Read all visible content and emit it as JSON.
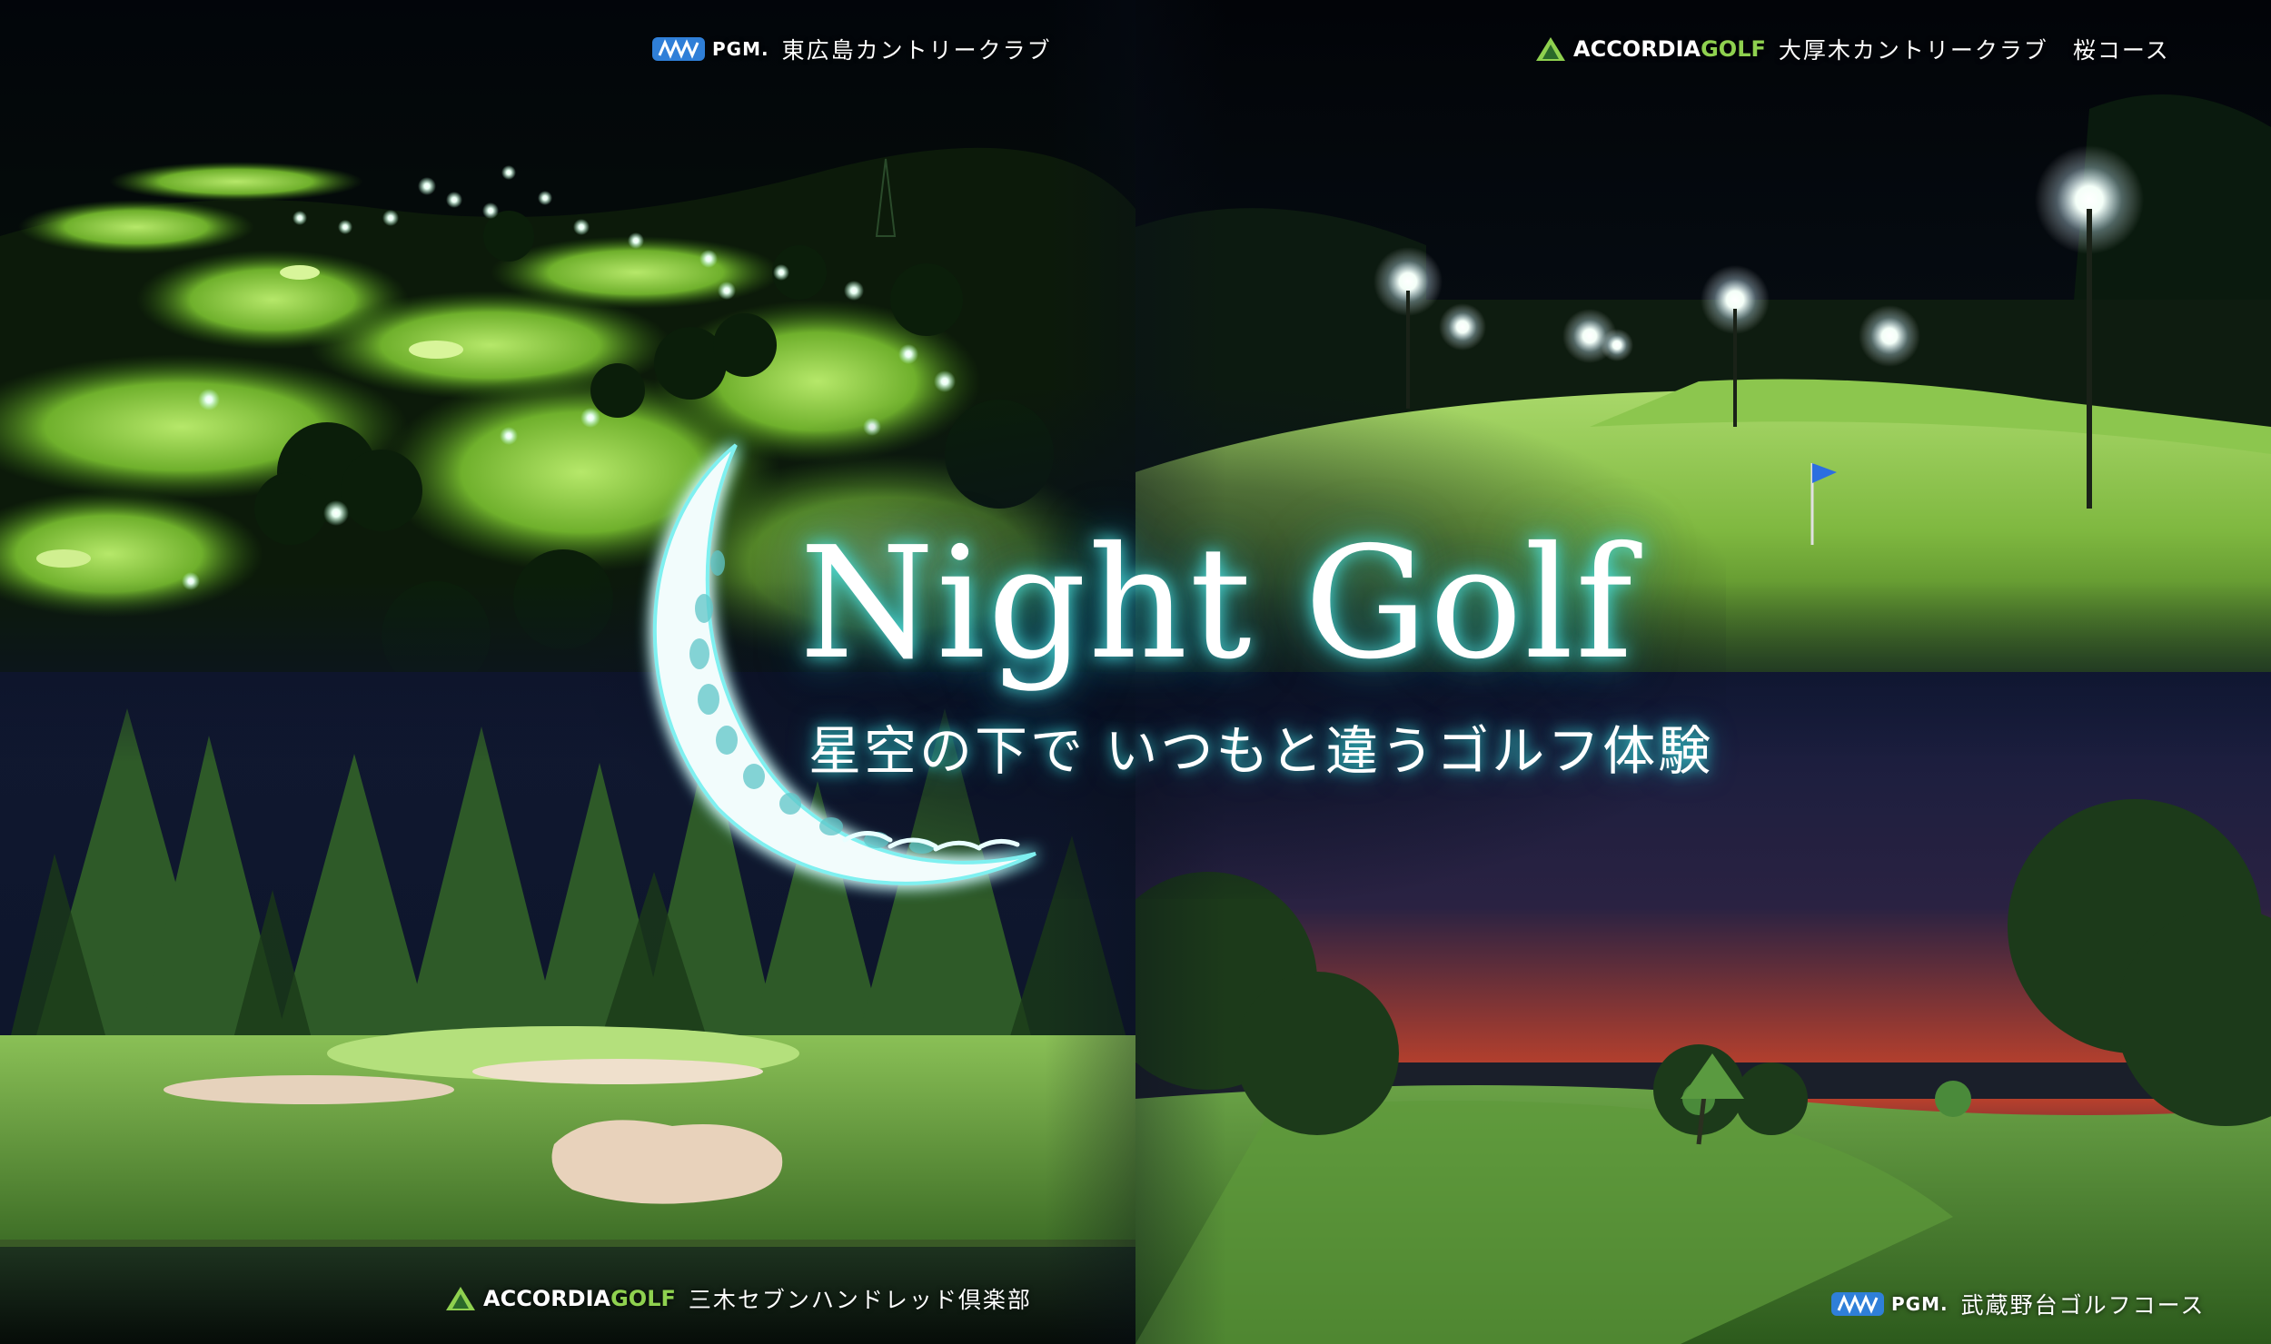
{
  "headline": {
    "title": "Night Golf",
    "tagline": "星空の下で いつもと違うゴルフ体験"
  },
  "courses": {
    "top_left": {
      "brand": "PGM.",
      "name": "東広島カントリークラブ"
    },
    "top_right": {
      "brand_a": "ACCORDIA",
      "brand_b": "GOLF",
      "name": "大厚木カントリークラブ　桜コース"
    },
    "bottom_left": {
      "brand_a": "ACCORDIA",
      "brand_b": "GOLF",
      "name": "三木セブンハンドレッド倶楽部"
    },
    "bottom_right": {
      "brand": "PGM.",
      "name": "武蔵野台ゴルフコース"
    }
  },
  "colors": {
    "glow": "#3ee0e0",
    "accordia_green": "#8fd14f",
    "pgm_blue": "#2f7fd8",
    "fairway": "#7fc23a",
    "night_sky": "#0a1020"
  },
  "icons": [
    "pgm-logo-icon",
    "accordia-logo-icon",
    "crescent-moon-icon"
  ]
}
